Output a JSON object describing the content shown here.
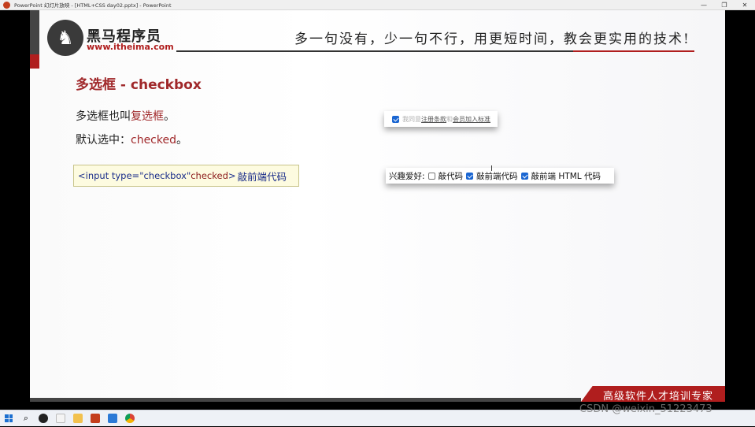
{
  "window": {
    "title": "PowerPoint 幻灯片放映 - [HTML+CSS day02.pptx] - PowerPoint",
    "minimize": "—",
    "maximize": "❐",
    "close": "✕"
  },
  "slide": {
    "logo_cn": "黑马程序员",
    "logo_url": "www.itheima.com",
    "slogan": "多一句没有，少一句不行，用更短时间，教会更实用的技术!",
    "title": "多选框 - checkbox",
    "line1_prefix": "多选框也叫",
    "line1_highlight": "复选框",
    "line1_suffix": "。",
    "line2_prefix": "默认选中：",
    "line2_highlight": "checked",
    "line2_suffix": "。",
    "code": {
      "tag_open": "<input type=\"checkbox\" ",
      "attr": "checked",
      "tag_close": ">",
      "text": "敲前端代码"
    },
    "demo1": {
      "text_gray": "我同意",
      "link1": "注册条款",
      "text_mid": "和",
      "link2": "会员加入标准"
    },
    "demo2": {
      "label": "兴趣爱好:",
      "options": [
        {
          "label": "敲代码",
          "checked": false
        },
        {
          "label": "敲前端代码",
          "checked": true
        },
        {
          "label": "敲前端 HTML 代码",
          "checked": true
        }
      ]
    },
    "banner": "高级软件人才培训专家"
  },
  "watermark": "CSDN @weixin_51223473",
  "colors": {
    "accent_red": "#b01e1e",
    "title_red": "#a0282a",
    "checkbox_blue": "#1a66d2",
    "code_bg": "#fdfbe0"
  }
}
